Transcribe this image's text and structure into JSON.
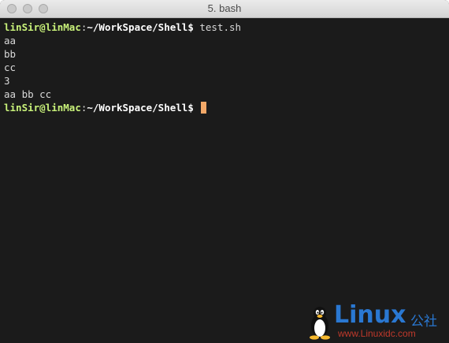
{
  "window": {
    "title": "5. bash"
  },
  "terminal": {
    "prompt": {
      "user": "linSir",
      "at": "@",
      "host": "linMac",
      "sep": ":",
      "path": "~/WorkSpace/Shell",
      "dollar": "$"
    },
    "command1": " test.sh",
    "output": [
      "aa",
      "bb",
      "cc",
      "3",
      "aa bb cc"
    ]
  },
  "watermark": {
    "brand": "Linux",
    "cjk": "公社",
    "url": "www.Linuxidc.com"
  },
  "colors": {
    "background": "#1b1b1b",
    "prompt_green": "#c9f27a",
    "cursor": "#f3a868",
    "watermark_blue": "#2a78d2",
    "watermark_red": "#c0392b"
  }
}
